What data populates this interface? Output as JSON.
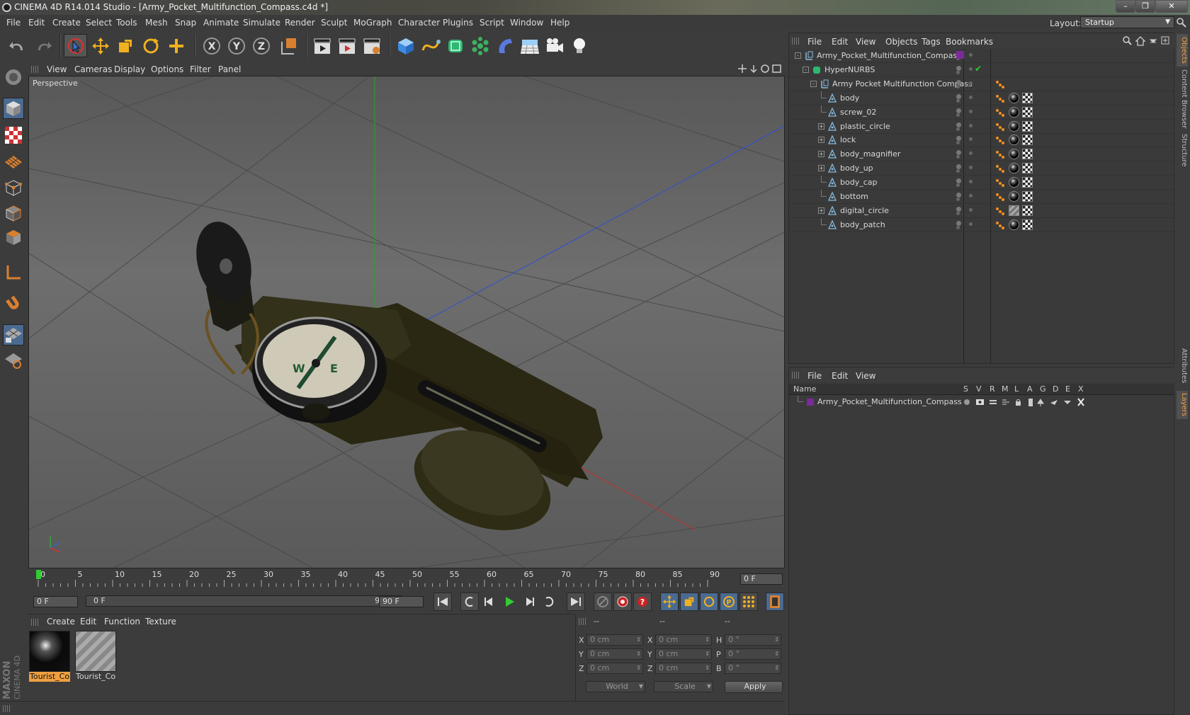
{
  "titlebar": {
    "title": "CINEMA 4D R14.014 Studio - [Army_Pocket_Multifunction_Compass.c4d *]"
  },
  "menubar": {
    "items": [
      "File",
      "Edit",
      "Create",
      "Select",
      "Tools",
      "Mesh",
      "Snap",
      "Animate",
      "Simulate",
      "Render",
      "Sculpt",
      "MoGraph",
      "Character",
      "Plugins",
      "Script",
      "Window",
      "Help"
    ]
  },
  "layout": {
    "label": "Layout:",
    "value": "Startup"
  },
  "viewport": {
    "menu": [
      "View",
      "Cameras",
      "Display",
      "Options",
      "Filter",
      "Panel"
    ],
    "label": "Perspective",
    "compass_letters": {
      "west": "W",
      "east": "E"
    }
  },
  "timeline": {
    "ticks": [
      "0",
      "5",
      "10",
      "15",
      "20",
      "25",
      "30",
      "35",
      "40",
      "45",
      "50",
      "55",
      "60",
      "65",
      "70",
      "75",
      "80",
      "85",
      "90"
    ],
    "current_frame_field": "0 F"
  },
  "playbar": {
    "start_field": "0 F",
    "range_start": "0 F",
    "range_end": "90 F",
    "end_field": "90 F"
  },
  "material_panel": {
    "menu": [
      "Create",
      "Edit",
      "Function",
      "Texture"
    ],
    "materials": [
      {
        "name": "Tourist_Cor",
        "selected": true
      },
      {
        "name": "Tourist_Cor",
        "selected": false
      }
    ]
  },
  "coord_panel": {
    "col_headers": [
      "--",
      "--",
      "--"
    ],
    "rows": [
      {
        "l1": "X",
        "v1": "0 cm",
        "l2": "X",
        "v2": "0 cm",
        "l3": "H",
        "v3": "0 °"
      },
      {
        "l1": "Y",
        "v1": "0 cm",
        "l2": "Y",
        "v2": "0 cm",
        "l3": "P",
        "v3": "0 °"
      },
      {
        "l1": "Z",
        "v1": "0 cm",
        "l2": "Z",
        "v2": "0 cm",
        "l3": "B",
        "v3": "0 °"
      }
    ],
    "world": "World",
    "scale": "Scale",
    "apply": "Apply"
  },
  "object_manager": {
    "menu": [
      "File",
      "Edit",
      "View",
      "Objects",
      "Tags",
      "Bookmarks"
    ],
    "objects": [
      {
        "name": "Army_Pocket_Multifunction_Compass",
        "indent": 0,
        "expand": "-",
        "icon": "null",
        "tags": "layer"
      },
      {
        "name": "HyperNURBS",
        "indent": 1,
        "expand": "-",
        "icon": "nurbs",
        "tags": "check"
      },
      {
        "name": "Army Pocket Multifunction Compass",
        "indent": 2,
        "expand": "-",
        "icon": "null",
        "tags": "phong"
      },
      {
        "name": "body",
        "indent": 3,
        "expand": "",
        "icon": "poly",
        "tags": "full"
      },
      {
        "name": "screw_02",
        "indent": 3,
        "expand": "",
        "icon": "poly",
        "tags": "full"
      },
      {
        "name": "plastic_circle",
        "indent": 3,
        "expand": "+",
        "icon": "poly",
        "tags": "full"
      },
      {
        "name": "lock",
        "indent": 3,
        "expand": "+",
        "icon": "poly",
        "tags": "full"
      },
      {
        "name": "body_magnifier",
        "indent": 3,
        "expand": "+",
        "icon": "poly",
        "tags": "full"
      },
      {
        "name": "body_up",
        "indent": 3,
        "expand": "+",
        "icon": "poly",
        "tags": "full"
      },
      {
        "name": "body_cap",
        "indent": 3,
        "expand": "",
        "icon": "poly",
        "tags": "full"
      },
      {
        "name": "bottom",
        "indent": 3,
        "expand": "",
        "icon": "poly",
        "tags": "full"
      },
      {
        "name": "digital_circle",
        "indent": 3,
        "expand": "+",
        "icon": "poly",
        "tags": "gray"
      },
      {
        "name": "body_patch",
        "indent": 3,
        "expand": "",
        "icon": "poly",
        "tags": "full"
      }
    ]
  },
  "layer_manager": {
    "menu": [
      "File",
      "Edit",
      "View"
    ],
    "columns": [
      "Name",
      "S",
      "V",
      "R",
      "M",
      "L",
      "A",
      "G",
      "D",
      "E",
      "X"
    ],
    "layers": [
      {
        "name": "Army_Pocket_Multifunction_Compass",
        "color": "#7a2a9a"
      }
    ]
  },
  "right_tabs": [
    "Objects",
    "Content Browser",
    "Structure",
    "Attributes",
    "Layers"
  ],
  "colors": {
    "accent": "#f0a040",
    "selected_axis": "#5a8ad0",
    "layer_purple": "#7a2a9a"
  }
}
